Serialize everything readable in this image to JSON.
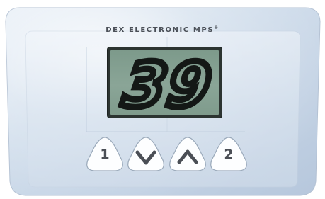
{
  "brand": {
    "name": "DEX ELECTRONIC MPS",
    "mark": "®"
  },
  "display": {
    "value": "39"
  },
  "buttons": [
    {
      "id": "preset-1",
      "label": "1",
      "icon": ""
    },
    {
      "id": "down",
      "label": "",
      "icon": "chevron-down-icon"
    },
    {
      "id": "up",
      "label": "",
      "icon": "chevron-up-icon"
    },
    {
      "id": "preset-2",
      "label": "2",
      "icon": ""
    }
  ],
  "colors": {
    "panel": "#c9d7e8",
    "lcd": "#86a293",
    "segment": "#141816"
  }
}
